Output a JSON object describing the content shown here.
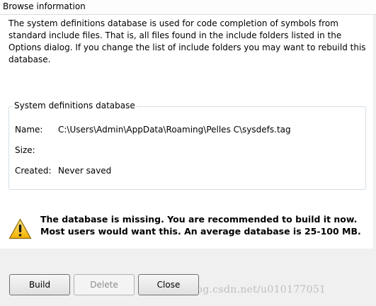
{
  "window": {
    "title": "Browse information"
  },
  "intro": {
    "text": "The system definitions database is used for code completion of symbols from standard include files. That is, all files found in the include folders listed in the Options dialog. If you change the list of include folders you may want to rebuild this database."
  },
  "database": {
    "group_title": "System definitions database",
    "name_label": "Name:",
    "name_value": "C:\\Users\\Admin\\AppData\\Roaming\\Pelles C\\sysdefs.tag",
    "size_label": "Size:",
    "size_value": "",
    "created_label": "Created:",
    "created_value": "Never saved"
  },
  "warning": {
    "icon": "warning-triangle-icon",
    "text": "The database is missing. You are recommended to build it now. Most users would want this. An average database is 25-100 MB."
  },
  "buttons": {
    "build": "Build",
    "delete": "Delete",
    "close": "Close"
  },
  "watermark": "http://blog.csdn.net/u010177051"
}
